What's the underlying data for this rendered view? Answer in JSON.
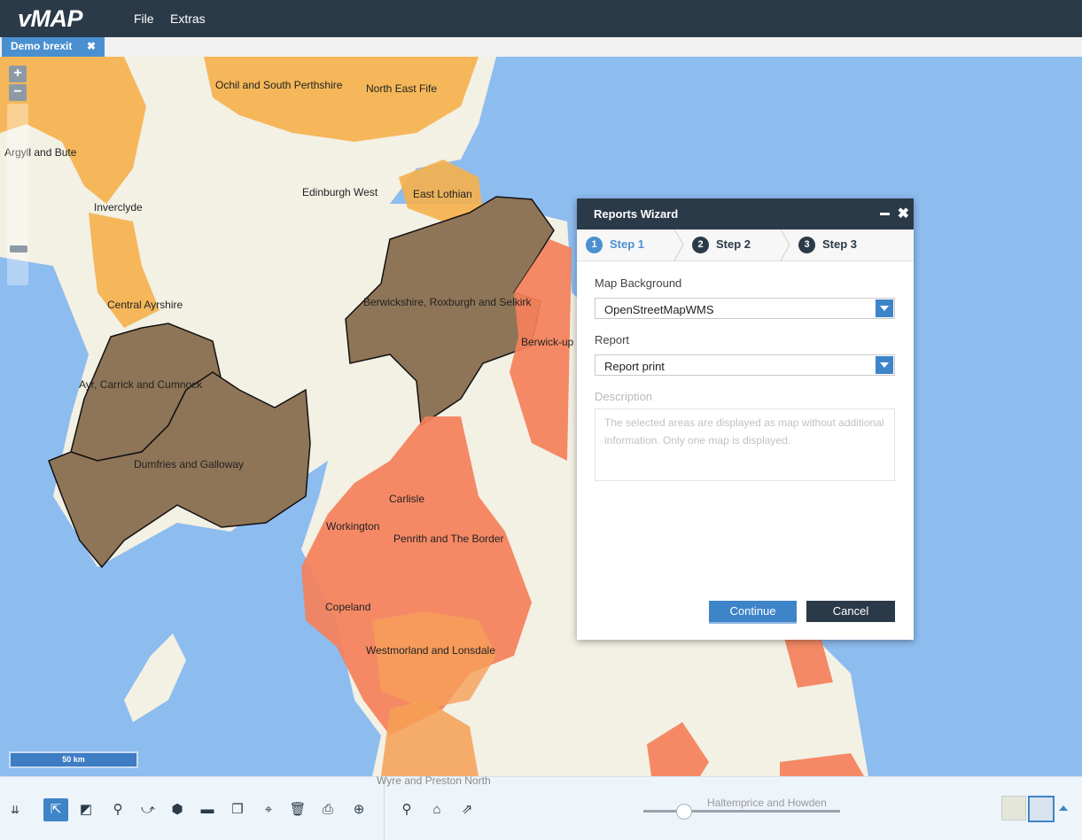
{
  "app": {
    "logo": "vMAP"
  },
  "menu": {
    "file": "File",
    "extras": "Extras"
  },
  "tab": {
    "label": "Demo brexit",
    "close": "✖"
  },
  "zoom": {
    "plus": "+",
    "minus": "−"
  },
  "scale": {
    "label": "50 km"
  },
  "map_labels": {
    "ochil": "Ochil and South Perthshire",
    "north_east_fife": "North East Fife",
    "argyll": "Argyll and Bute",
    "edinburgh_west": "Edinburgh West",
    "east_lothian": "East Lothian",
    "inverclyde": "Inverclyde",
    "central_ayrshire": "Central Ayrshire",
    "berwickshire": "Berwickshire, Roxburgh and Selkirk",
    "berwick": "Berwick-up",
    "ayr": "Ayr, Carrick and Cumnock",
    "dumfries": "Dumfries and Galloway",
    "carlisle": "Carlisle",
    "workington": "Workington",
    "penrith": "Penrith and The Border",
    "copeland": "Copeland",
    "westmorland": "Westmorland and Lonsdale",
    "wyre": "Wyre and Preston North",
    "haltemprice": "Haltemprice and Howden"
  },
  "dialog": {
    "title": "Reports Wizard",
    "steps": [
      {
        "num": "1",
        "label": "Step 1"
      },
      {
        "num": "2",
        "label": "Step 2"
      },
      {
        "num": "3",
        "label": "Step 3"
      }
    ],
    "map_background_label": "Map Background",
    "map_background_value": "OpenStreetMapWMS",
    "report_label": "Report",
    "report_value": "Report print",
    "description_label": "Description",
    "description_text": "The selected areas are displayed as map without additional information. Only one map is displayed.",
    "continue": "Continue",
    "cancel": "Cancel"
  },
  "toolbar": {
    "icons": [
      "collapse-icon",
      "select-add-icon",
      "eraser-icon",
      "pin-icon",
      "draw-line-icon",
      "polygon-icon",
      "measure-icon",
      "copy-layer-icon",
      "map-route-icon",
      "delete-icon",
      "print-icon",
      "zoom-in-icon",
      "search-icon",
      "home-icon",
      "share-icon"
    ],
    "colors": {
      "accent": "#3e84c8",
      "header": "#2b3a48"
    }
  }
}
